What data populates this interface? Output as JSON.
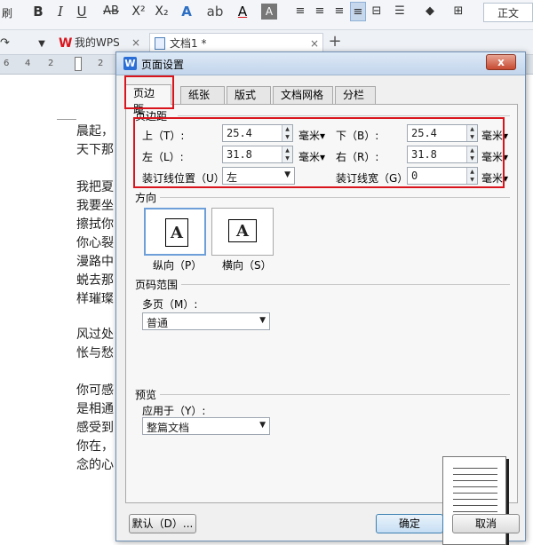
{
  "app": {
    "toolbar": {
      "left_fragment": "刷",
      "bold": "B",
      "italic": "I",
      "underline": "U",
      "strike": "AB",
      "superscript": "X²",
      "subscript": "X₂",
      "style_name": "正文"
    },
    "tabs": [
      {
        "label": "我的WPS"
      },
      {
        "label": "文档1 *"
      }
    ],
    "ruler_numbers": [
      "6",
      "4",
      "2",
      "2"
    ],
    "doc_lines": [
      "晨起，",
      "天下那",
      "我把夏",
      "我要坐",
      "擦拭你",
      "你心裂",
      "漫路中",
      "蜕去那",
      "样璀璨",
      "风过处",
      "怅与愁",
      "你可感",
      "是相通",
      "感受到",
      "你在，",
      "念的心"
    ]
  },
  "dialog": {
    "title": "页面设置",
    "close": "x",
    "tabs": [
      "页边距",
      "纸张",
      "版式",
      "文档网格",
      "分栏"
    ],
    "margins": {
      "section": "页边距",
      "top": {
        "label": "上（T）:",
        "value": "25.4",
        "unit": "毫米"
      },
      "bottom": {
        "label": "下（B）:",
        "value": "25.4",
        "unit": "毫米"
      },
      "left": {
        "label": "左（L）:",
        "value": "31.8",
        "unit": "毫米"
      },
      "right": {
        "label": "右（R）:",
        "value": "31.8",
        "unit": "毫米"
      },
      "gutter_pos": {
        "label": "装订线位置（U）:",
        "value": "左"
      },
      "gutter_width": {
        "label": "装订线宽（G）:",
        "value": "0",
        "unit": "毫米"
      }
    },
    "orientation": {
      "section": "方向",
      "glyph": "A",
      "portrait": "纵向（P）",
      "landscape": "横向（S）"
    },
    "page_range": {
      "section": "页码范围",
      "multi_label": "多页（M）:",
      "multi_value": "普通"
    },
    "preview": {
      "section": "预览",
      "apply_label": "应用于（Y）:",
      "apply_value": "整篇文档"
    },
    "buttons": {
      "default": "默认（D）...",
      "ok": "确定",
      "cancel": "取消"
    }
  }
}
